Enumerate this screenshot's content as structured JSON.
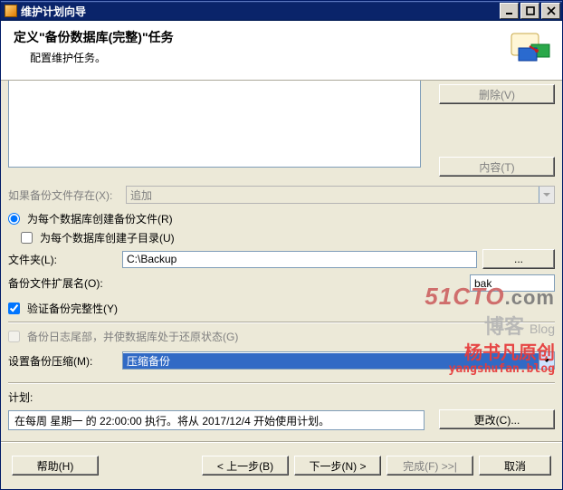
{
  "window": {
    "title": "维护计划向导",
    "header_title": "定义\"备份数据库(完整)\"任务",
    "header_sub": "配置维护任务。"
  },
  "buttons": {
    "delete": "删除(V)",
    "content": "内容(T)",
    "browse": "...",
    "change": "更改(C)...",
    "help": "帮助(H)",
    "prev": "< 上一步(B)",
    "next": "下一步(N) >",
    "finish": "完成(F) >>|",
    "cancel": "取消"
  },
  "labels": {
    "if_exists": "如果备份文件存在(X):",
    "append": "追加",
    "create_file_per_db": "为每个数据库创建备份文件(R)",
    "create_sub_per_db": "为每个数据库创建子目录(U)",
    "folder": "文件夹(L):",
    "ext": "备份文件扩展名(O):",
    "verify": "验证备份完整性(Y)",
    "tail_log": "备份日志尾部，并使数据库处于还原状态(G)",
    "compression": "设置备份压缩(M):",
    "schedule": "计划:"
  },
  "values": {
    "folder": "C:\\Backup",
    "ext": "bak",
    "compression": "压缩备份",
    "schedule_text": "在每周 星期一 的 22:00:00 执行。将从 2017/12/4 开始使用计划。"
  },
  "state": {
    "radio_create_file": true,
    "chk_subdir": false,
    "chk_verify": true,
    "chk_taillog": false
  },
  "watermark": {
    "l1a": "51CTO",
    "l1b": ".com",
    "l2a": "博客",
    "l2b": "Blog",
    "l3": "杨书凡原创",
    "l4": "yangshufan.blog"
  }
}
